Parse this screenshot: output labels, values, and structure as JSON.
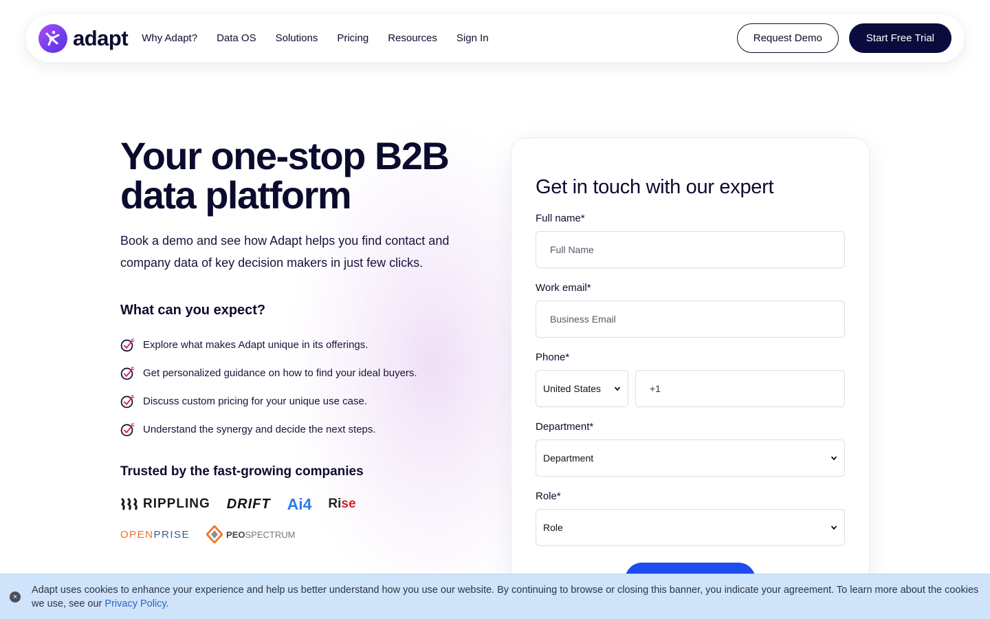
{
  "nav": {
    "logo_text": "adapt",
    "links": [
      "Why Adapt?",
      "Data OS",
      "Solutions",
      "Pricing",
      "Resources",
      "Sign In"
    ],
    "request_demo": "Request Demo",
    "start_trial": "Start Free Trial"
  },
  "hero": {
    "title_line1": "Your one-stop B2B",
    "title_line2": "data platform",
    "subtitle": "Book a demo and see how Adapt helps you find contact and company data of key decision makers in just few clicks.",
    "expect_title": "What can you expect?",
    "expect_items": [
      "Explore what makes Adapt unique in its offerings.",
      "Get personalized guidance on how to find your ideal buyers.",
      "Discuss custom pricing for your unique use case.",
      "Understand the synergy and decide the next steps."
    ],
    "trusted_title": "Trusted by the fast-growing companies",
    "companies": [
      "RIPPLING",
      "DRIFT",
      "Ai4",
      "Rise",
      "OPENPRISE",
      "PEOSPECTRUM"
    ],
    "company_parts": {
      "open": "OPEN",
      "prise": "PRISE",
      "peo": "PEO",
      "spectrum": "SPECTRUM",
      "ri": "Ri",
      "se": "se"
    }
  },
  "form": {
    "title": "Get in touch with our expert",
    "full_name_label": "Full name*",
    "full_name_placeholder": "Full Name",
    "email_label": "Work email*",
    "email_placeholder": "Business Email",
    "phone_label": "Phone*",
    "country_value": "United States",
    "phone_value": "+1",
    "department_label": "Department*",
    "department_value": "Department",
    "role_label": "Role*",
    "role_value": "Role"
  },
  "cookie": {
    "text": "Adapt uses cookies to enhance your experience and help us better understand how you use our website. By continuing to browse or closing this banner, you indicate your agreement. To learn more about the cookies we use, see our ",
    "link": "Privacy Policy",
    "end": ".",
    "close": "×"
  },
  "colors": {
    "navy": "#0c0b3d",
    "primary_blue": "#1f4bf0",
    "cookie_bg": "#cfe3fb",
    "logo_purple": "#7a3ff0"
  }
}
